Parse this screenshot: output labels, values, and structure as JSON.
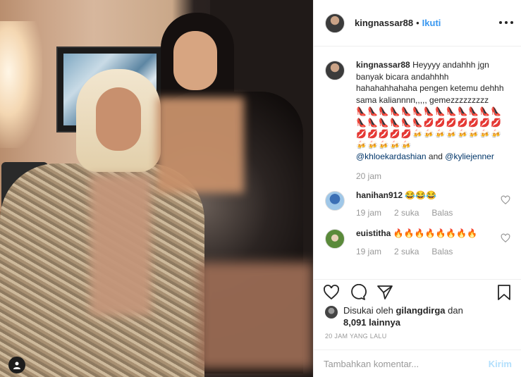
{
  "post": {
    "username": "kingnassar88",
    "dot": "•",
    "follow_label": "Ikuti"
  },
  "caption": {
    "username": "kingnassar88",
    "text": "Heyyyy andahhh jgn banyak bicara andahhhh hahahahhahaha pengen ketemu dehhh sama kaliannnn,,,,, gemezzzzzzzzz",
    "emojis": "👠👠👠👠👠👠👠👠👠👠👠👠👠👠👠👠👠👠👠💋💋💋💋💋💋💋💋💋💋💋💋🍻🍻🍻🍻🍻🍻🍻🍻🍻🍻🍻🍻🍻",
    "mention1": "@khloekardashian",
    "and": "and",
    "mention2": "@kyliejenner",
    "time": "20 jam"
  },
  "comments": [
    {
      "username": "hanihan912",
      "text": "😂😂😂",
      "time": "19 jam",
      "likes": "2 suka",
      "reply": "Balas"
    },
    {
      "username": "euistitha",
      "text": "🔥🔥🔥🔥🔥🔥🔥🔥",
      "time": "19 jam",
      "likes": "2 suka",
      "reply": "Balas"
    }
  ],
  "likes": {
    "prefix": "Disukai oleh",
    "user": "gilangdirga",
    "middle": "dan",
    "count": "8,091 lainnya"
  },
  "timestamp": "20 JAM YANG LALU",
  "add_comment": {
    "placeholder": "Tambahkan komentar...",
    "send_label": "Kirim"
  },
  "colors": {
    "accent": "#3897f0",
    "send_disabled": "#b2dffc",
    "mention": "#003569",
    "muted": "#999999"
  }
}
